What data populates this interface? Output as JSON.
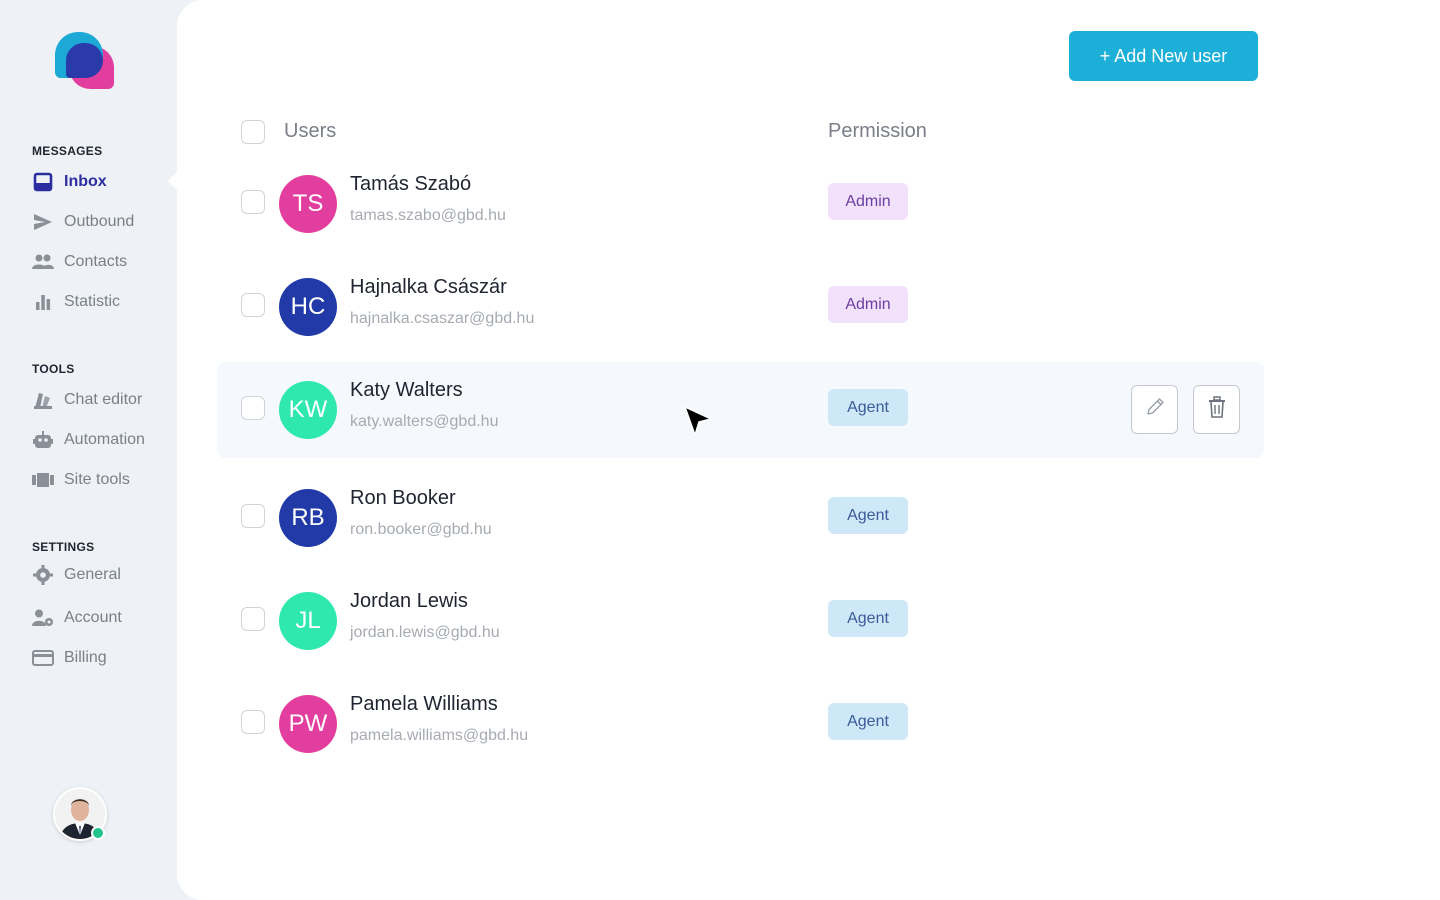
{
  "sidebar": {
    "sections": [
      {
        "label": "MESSAGES",
        "items": [
          {
            "label": "Inbox",
            "icon": "inbox-icon",
            "active": true
          },
          {
            "label": "Outbound",
            "icon": "send-icon"
          },
          {
            "label": "Contacts",
            "icon": "contacts-icon"
          },
          {
            "label": "Statistic",
            "icon": "bar-chart-icon"
          }
        ]
      },
      {
        "label": "TOOLS",
        "items": [
          {
            "label": "Chat editor",
            "icon": "palette-icon"
          },
          {
            "label": "Automation",
            "icon": "robot-icon"
          },
          {
            "label": "Site tools",
            "icon": "site-tools-icon"
          }
        ]
      },
      {
        "label": "SETTINGS",
        "items": [
          {
            "label": "General",
            "icon": "gear-icon"
          },
          {
            "label": "Account",
            "icon": "account-settings-icon"
          },
          {
            "label": "Billing",
            "icon": "credit-card-icon"
          }
        ]
      }
    ],
    "profile": {
      "status": "online"
    }
  },
  "toolbar": {
    "add_label": "+ Add New user"
  },
  "table": {
    "headers": {
      "users": "Users",
      "permission": "Permission"
    },
    "rows": [
      {
        "initials": "TS",
        "name": "Tamás Szabó",
        "email": "tamas.szabo@gbd.hu",
        "permission": "Admin",
        "avatar_color": "#e23ea0"
      },
      {
        "initials": "HC",
        "name": "Hajnalka Császár",
        "email": "hajnalka.csaszar@gbd.hu",
        "permission": "Admin",
        "avatar_color": "#213aa8"
      },
      {
        "initials": "KW",
        "name": "Katy Walters",
        "email": "katy.walters@gbd.hu",
        "permission": "Agent",
        "avatar_color": "#2ee8ad",
        "hovered": true
      },
      {
        "initials": "RB",
        "name": "Ron Booker",
        "email": "ron.booker@gbd.hu",
        "permission": "Agent",
        "avatar_color": "#213aa8"
      },
      {
        "initials": "JL",
        "name": "Jordan Lewis",
        "email": "jordan.lewis@gbd.hu",
        "permission": "Agent",
        "avatar_color": "#2ee8ad"
      },
      {
        "initials": "PW",
        "name": "Pamela Williams",
        "email": "pamela.williams@gbd.hu",
        "permission": "Agent",
        "avatar_color": "#e23ea0"
      }
    ]
  },
  "colors": {
    "accent": "#1cb0d8",
    "active_nav": "#2b2ea0",
    "admin_badge_bg": "#f1e1fb",
    "admin_badge_text": "#6b3fa0",
    "agent_badge_bg": "#cfe8f8",
    "agent_badge_text": "#3a5a9a"
  }
}
